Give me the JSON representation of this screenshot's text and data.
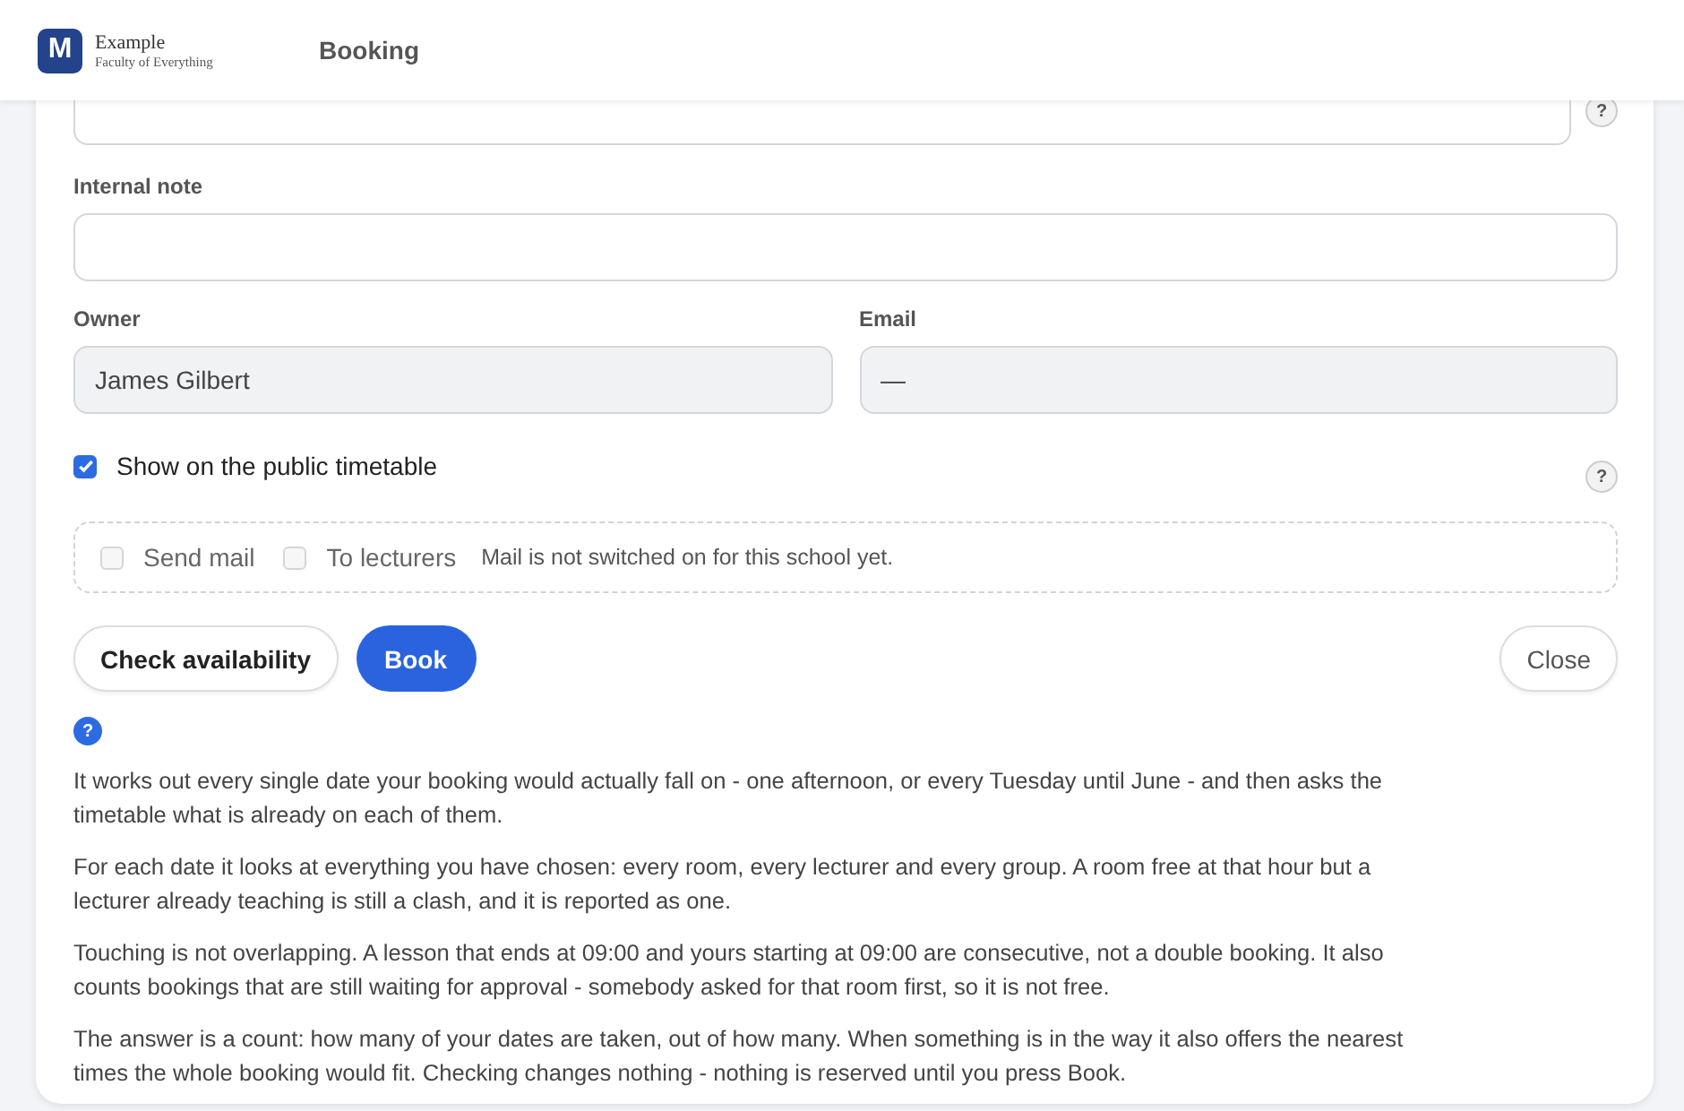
{
  "header": {
    "logo_letter": "M",
    "brand": "Example",
    "subtitle": "Faculty of Everything",
    "title": "Booking"
  },
  "form": {
    "top_field": {
      "kind": "text",
      "help": "?"
    },
    "internal_note": {
      "label": "Internal note"
    },
    "owner": {
      "label": "Owner",
      "value": "James Gilbert",
      "disabled": true
    },
    "email": {
      "label": "Email",
      "value": "—",
      "disabled": true
    },
    "public_timetable": {
      "label": "Show on the public timetable",
      "checked": true,
      "help": "?"
    },
    "mail": {
      "options": [
        {
          "label": "Send mail",
          "checked": false,
          "disabled": true
        },
        {
          "label": "To lecturers",
          "checked": false,
          "disabled": true
        }
      ],
      "note": "Mail is not switched on for this school yet."
    },
    "buttons": [
      {
        "label": "Check availability",
        "kind": "secondary"
      },
      {
        "label": "Book",
        "kind": "primary"
      },
      {
        "label": "Close",
        "kind": "secondary"
      }
    ],
    "info_help": "?",
    "info": [
      "It works out every single date your booking would actually fall on - one afternoon, or every Tuesday until June - and then asks the timetable what is already on each of them.",
      "For each date it looks at everything you have chosen: every room, every lecturer and every group. A room free at that hour but a lecturer already teaching is still a clash, and it is reported as one.",
      "Touching is not overlapping. A lesson that ends at 09:00 and yours starting at 09:00 are consecutive, not a double booking. It also counts bookings that are still waiting for approval - somebody asked for that room first, so it is not free.",
      "The answer is a count: how many of your dates are taken, out of how many. When something is in the way it also offers the nearest times the whole booking would fit. Checking changes nothing - nothing is reserved until you press Book."
    ]
  }
}
